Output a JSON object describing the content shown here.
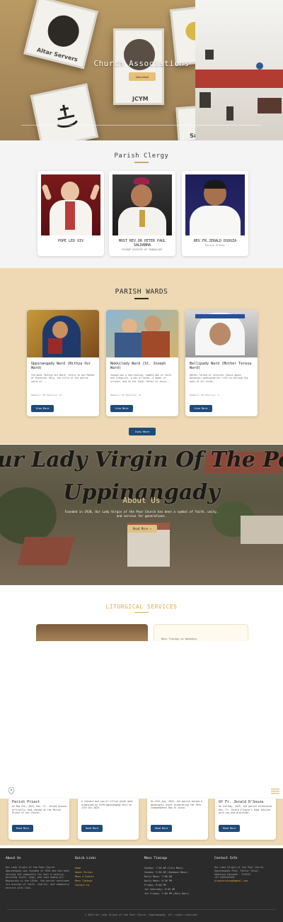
{
  "hero": {
    "title": "Church Associations",
    "button": "View More",
    "cards": [
      "Altar Servers",
      "JCYM",
      "Sa"
    ]
  },
  "clergy": {
    "title": "Parish Clergy",
    "cards": [
      {
        "name": "POPE LEO XIV",
        "role": ""
      },
      {
        "name": "MOST REV.DR PETER PAUL SALDANHA",
        "role": "BISHOP DIOCESE OF MANGALORE"
      },
      {
        "name": "REV.FR.JERALD DSOUZA",
        "role": "Parish Priest"
      }
    ]
  },
  "wards": {
    "title": "PARISH WARDS",
    "view_all": "View More",
    "cards": [
      {
        "title": "Uppinangady Ward (Nithya Our Ward)",
        "desc": "The Ward \"Nithya Our Ward\" refers to Our Mother of Perpetual Help, the title of the patron saint of...",
        "meta": "Members: 50   Families: 12",
        "button": "View More"
      },
      {
        "title": "Nekkilady Ward (St. Joseph Ward)",
        "desc": "Joseph was a God-fearing, humble man of faith and integrity, a man of honor, a model of silence, and of the loyal father of Jesus...",
        "meta": "Members: 45   Families: 10",
        "button": "View More"
      },
      {
        "title": "Bellipady Ward (Mother Teresa Ward)",
        "desc": "Mother Teresa of Calcutta (Saint Agnes Bojaxhiu) dedicated her life to serving the poor of all kinds...",
        "meta": "Members: 40   Families: 9",
        "button": "View More"
      }
    ]
  },
  "about": {
    "script_line1": "Our Lady Virgin Of The Poor Church",
    "script_line2": "Uppinangady",
    "title": "About Us",
    "text": "Founded in 1920, Our Lady Virgin of the Poor Church has been a symbol of faith, unity, and service for generations.",
    "button": "Read More →"
  },
  "liturgical": {
    "title": "LITURGICAL SERVICES",
    "card_text": "Mass Timings on Weekdays"
  },
  "announcements": [
    {
      "title": "Parish Priest",
      "desc": "On May 5th, 2025, Rev. Fr. Jerald Dsouza officially took charge as the Parish Priest of our Church.",
      "button": "Read More"
    },
    {
      "title": "",
      "desc": "A vibrant and spirit-filled youth meet organized by ICYM Uppinangady Unit on 11th Oct 2025.",
      "button": "Read More"
    },
    {
      "title": "",
      "desc": "On 15th Aug, 2025, the parish hosted a meaningful event celebrating the 79th Independence Day of India.",
      "button": "Read More"
    },
    {
      "title": "Of Fr. Jerald D'Souza",
      "desc": "On 2nd May, 2025, the parish celebrated Rev. Fr. Jerald D'Souza's Ruby Jubilee with joy and gratitude.",
      "button": "Read More"
    }
  ],
  "footer": {
    "about_head": "About Us",
    "about_text": "Our Lady Virgin of the Poor Church Uppinangady was founded in 1920 and has been serving the community for over a century, building faith, hope, and love among all. Beginning in the 1920s, the parish continues its mission of faith, charity, and community service with love.",
    "links_head": "Quick Links",
    "links": [
      "Home",
      "About Parish",
      "Mass & Events",
      "Mass Timings",
      "Contact Us"
    ],
    "mass_head": "Mass Timings",
    "mass": [
      "Sunday: 7:30 AM (Tulu Mass)",
      "Sunday: 9:30 AM (Konkani Mass)",
      "Daily Mass: 7:00 AM",
      "Daily Mass: 6:30 PM",
      "Friday: 6:00 PM",
      "1st Saturday: 9:30 AM",
      "1st Friday: 7:00 PM (Holy Hour)"
    ],
    "contact_head": "Contact Info",
    "contact": [
      "Our Lady Virgin of the Poor Church",
      "Uppinangady Post, Puttur Taluk,",
      "Dakshina Kannada - 574241",
      "+91 XXXXXXXXXX",
      "olvpchurchupp@gmail.com"
    ],
    "copyright": "© 2025 Our Lady Virgin of the Poor Church, Uppinangady. All rights reserved."
  }
}
